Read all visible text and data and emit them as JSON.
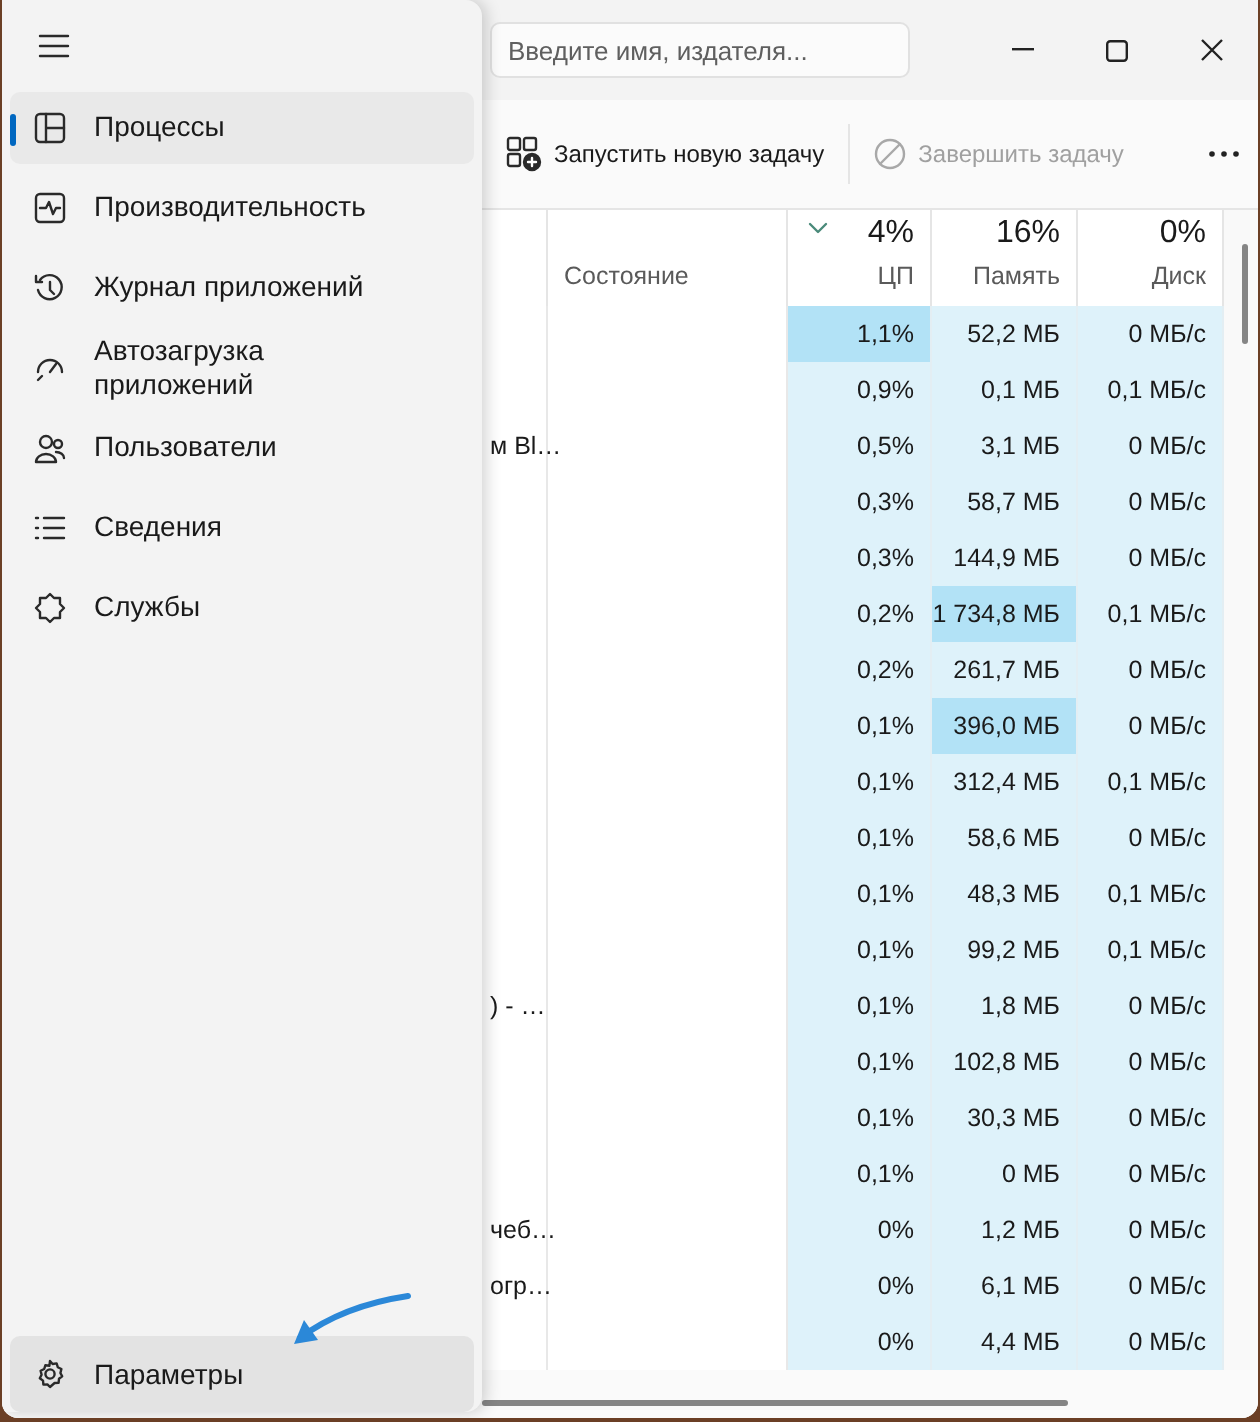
{
  "search": {
    "placeholder": "Введите имя, издателя..."
  },
  "commands": [
    {
      "label": "Запустить новую задачу",
      "disabled": false
    },
    {
      "label": "Завершить задачу",
      "disabled": true
    }
  ],
  "table": {
    "columns": [
      {
        "title": "Состояние",
        "sorted": false
      },
      {
        "total": "4%",
        "title": "ЦП",
        "sorted": true
      },
      {
        "total": "16%",
        "title": "Память",
        "sorted": false
      },
      {
        "total": "0%",
        "title": "Диск",
        "sorted": false
      }
    ],
    "rows": [
      {
        "name": "",
        "cpu": "1,1%",
        "memory": "52,2 МБ",
        "disk": "0 МБ/с",
        "cpu_hot": true,
        "memory_hot": false
      },
      {
        "name": "",
        "cpu": "0,9%",
        "memory": "0,1 МБ",
        "disk": "0,1 МБ/с",
        "cpu_hot": false,
        "memory_hot": false
      },
      {
        "name": "м Bl…",
        "cpu": "0,5%",
        "memory": "3,1 МБ",
        "disk": "0 МБ/с",
        "cpu_hot": false,
        "memory_hot": false
      },
      {
        "name": "",
        "cpu": "0,3%",
        "memory": "58,7 МБ",
        "disk": "0 МБ/с",
        "cpu_hot": false,
        "memory_hot": false
      },
      {
        "name": "",
        "cpu": "0,3%",
        "memory": "144,9 МБ",
        "disk": "0 МБ/с",
        "cpu_hot": false,
        "memory_hot": false
      },
      {
        "name": "",
        "cpu": "0,2%",
        "memory": "1 734,8 МБ",
        "disk": "0,1 МБ/с",
        "cpu_hot": false,
        "memory_hot": true
      },
      {
        "name": "",
        "cpu": "0,2%",
        "memory": "261,7 МБ",
        "disk": "0 МБ/с",
        "cpu_hot": false,
        "memory_hot": false
      },
      {
        "name": "",
        "cpu": "0,1%",
        "memory": "396,0 МБ",
        "disk": "0 МБ/с",
        "cpu_hot": false,
        "memory_hot": true
      },
      {
        "name": "",
        "cpu": "0,1%",
        "memory": "312,4 МБ",
        "disk": "0,1 МБ/с",
        "cpu_hot": false,
        "memory_hot": false
      },
      {
        "name": "",
        "cpu": "0,1%",
        "memory": "58,6 МБ",
        "disk": "0 МБ/с",
        "cpu_hot": false,
        "memory_hot": false
      },
      {
        "name": "",
        "cpu": "0,1%",
        "memory": "48,3 МБ",
        "disk": "0,1 МБ/с",
        "cpu_hot": false,
        "memory_hot": false
      },
      {
        "name": "",
        "cpu": "0,1%",
        "memory": "99,2 МБ",
        "disk": "0,1 МБ/с",
        "cpu_hot": false,
        "memory_hot": false
      },
      {
        "name": ") - …",
        "cpu": "0,1%",
        "memory": "1,8 МБ",
        "disk": "0 МБ/с",
        "cpu_hot": false,
        "memory_hot": false
      },
      {
        "name": "",
        "cpu": "0,1%",
        "memory": "102,8 МБ",
        "disk": "0 МБ/с",
        "cpu_hot": false,
        "memory_hot": false
      },
      {
        "name": "",
        "cpu": "0,1%",
        "memory": "30,3 МБ",
        "disk": "0 МБ/с",
        "cpu_hot": false,
        "memory_hot": false
      },
      {
        "name": "",
        "cpu": "0,1%",
        "memory": "0 МБ",
        "disk": "0 МБ/с",
        "cpu_hot": false,
        "memory_hot": false
      },
      {
        "name": "чеб…",
        "cpu": "0%",
        "memory": "1,2 МБ",
        "disk": "0 МБ/с",
        "cpu_hot": false,
        "memory_hot": false
      },
      {
        "name": "огр…",
        "cpu": "0%",
        "memory": "6,1 МБ",
        "disk": "0 МБ/с",
        "cpu_hot": false,
        "memory_hot": false
      },
      {
        "name": "",
        "cpu": "0%",
        "memory": "4,4 МБ",
        "disk": "0 МБ/с",
        "cpu_hot": false,
        "memory_hot": false
      }
    ]
  },
  "sidebar": {
    "items": [
      {
        "label": "Процессы",
        "selected": true
      },
      {
        "label": "Производительность",
        "selected": false
      },
      {
        "label": "Журнал приложений",
        "selected": false
      },
      {
        "label": "Автозагрузка приложений",
        "selected": false
      },
      {
        "label": "Пользователи",
        "selected": false
      },
      {
        "label": "Сведения",
        "selected": false
      },
      {
        "label": "Службы",
        "selected": false
      }
    ],
    "settings": {
      "label": "Параметры",
      "hovered": true
    }
  }
}
